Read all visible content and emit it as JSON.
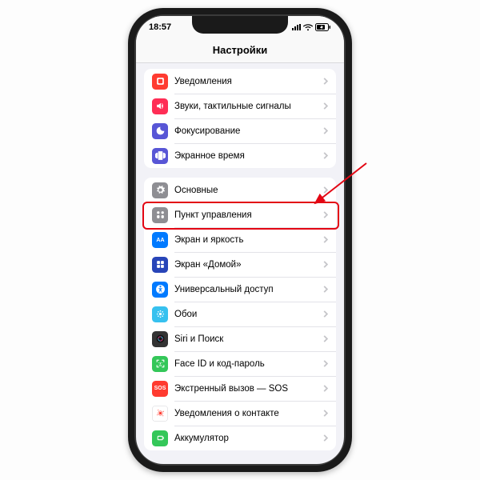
{
  "status": {
    "time": "18:57"
  },
  "header": {
    "title": "Настройки"
  },
  "groups": [
    {
      "rows": [
        {
          "id": "notifications",
          "label": "Уведомления",
          "color": "#ff3b30"
        },
        {
          "id": "sounds",
          "label": "Звуки, тактильные сигналы",
          "color": "#ff2d55"
        },
        {
          "id": "focus",
          "label": "Фокусирование",
          "color": "#5856d6"
        },
        {
          "id": "screentime",
          "label": "Экранное время",
          "color": "#5856d6"
        }
      ]
    },
    {
      "rows": [
        {
          "id": "general",
          "label": "Основные",
          "color": "#8e8e93"
        },
        {
          "id": "controlcenter",
          "label": "Пункт управления",
          "color": "#8e8e93",
          "highlight": true
        },
        {
          "id": "display",
          "label": "Экран и яркость",
          "color": "#007aff"
        },
        {
          "id": "homescreen",
          "label": "Экран «Домой»",
          "color": "#2845b8"
        },
        {
          "id": "accessibility",
          "label": "Универсальный доступ",
          "color": "#007aff"
        },
        {
          "id": "wallpaper",
          "label": "Обои",
          "color": "#37c1ef"
        },
        {
          "id": "siri",
          "label": "Siri и Поиск",
          "color": "#333333"
        },
        {
          "id": "faceid",
          "label": "Face ID и код-пароль",
          "color": "#34c759"
        },
        {
          "id": "sos",
          "label": "Экстренный вызов — SOS",
          "color": "#ff3b30",
          "text": "SOS"
        },
        {
          "id": "exposure",
          "label": "Уведомления о контакте",
          "color": "#ffffff",
          "border": true
        },
        {
          "id": "battery",
          "label": "Аккумулятор",
          "color": "#34c759"
        }
      ]
    }
  ]
}
